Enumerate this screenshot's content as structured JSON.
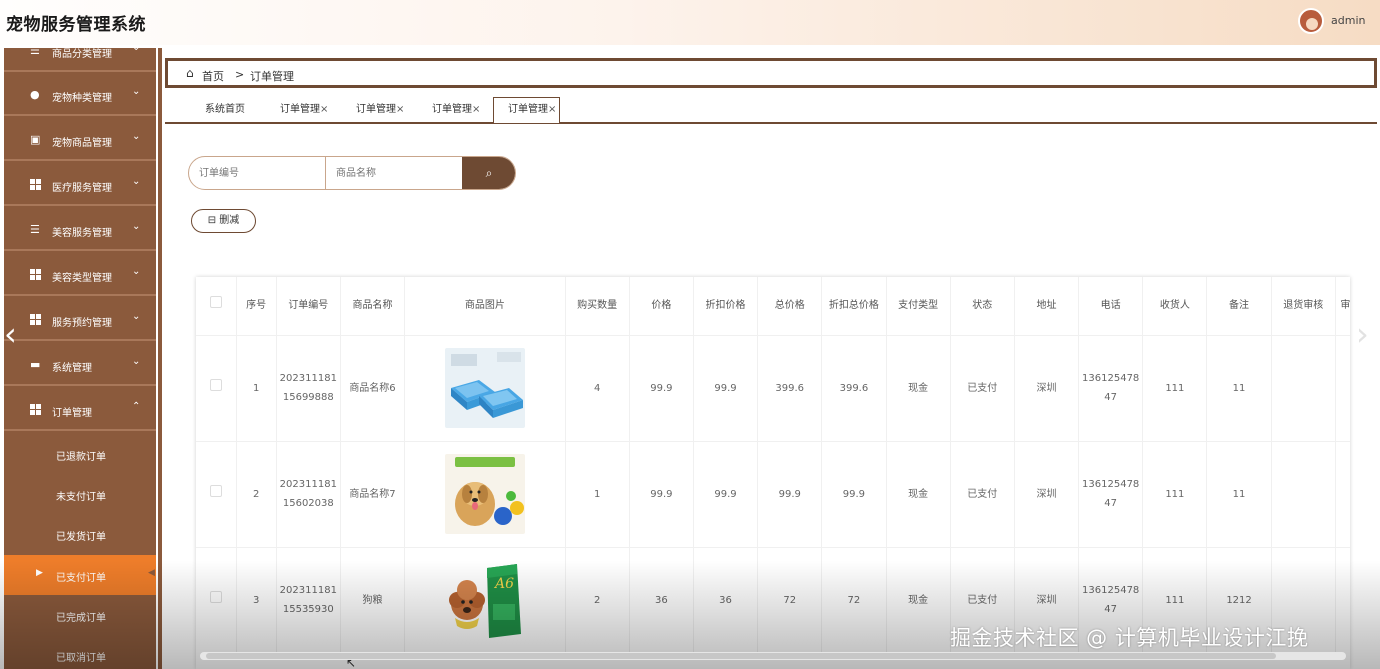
{
  "app": {
    "title": "宠物服务管理系统",
    "user": "admin"
  },
  "sidebar": {
    "items": [
      {
        "label": "商品分类管理",
        "icon": "menu-icon"
      },
      {
        "label": "宠物种类管理",
        "icon": "bulb-icon"
      },
      {
        "label": "宠物商品管理",
        "icon": "clipboard-icon"
      },
      {
        "label": "医疗服务管理",
        "icon": "grid-icon"
      },
      {
        "label": "美容服务管理",
        "icon": "menu-icon"
      },
      {
        "label": "美容类型管理",
        "icon": "grid-icon"
      },
      {
        "label": "服务预约管理",
        "icon": "grid-icon"
      },
      {
        "label": "系统管理",
        "icon": "printer-icon"
      },
      {
        "label": "订单管理",
        "icon": "grid-icon"
      }
    ],
    "subitems": [
      {
        "label": "已退款订单"
      },
      {
        "label": "未支付订单"
      },
      {
        "label": "已发货订单"
      },
      {
        "label": "已支付订单"
      },
      {
        "label": "已完成订单"
      },
      {
        "label": "已取消订单"
      }
    ]
  },
  "breadcrumb": {
    "home": "首页",
    "sep": ">",
    "current": "订单管理"
  },
  "tabs": [
    {
      "label": "系统首页",
      "closable": ""
    },
    {
      "label": "订单管理",
      "closable": "×"
    },
    {
      "label": "订单管理",
      "closable": "×"
    },
    {
      "label": "订单管理",
      "closable": "×"
    },
    {
      "label": "订单管理",
      "closable": "×"
    }
  ],
  "search": {
    "order_placeholder": "订单编号",
    "name_placeholder": "商品名称",
    "search_icon": "search-icon"
  },
  "actions": {
    "delete_label": "删减",
    "delete_icon": "minus-square-icon"
  },
  "table": {
    "headers": [
      "序号",
      "订单编号",
      "商品名称",
      "商品图片",
      "购买数量",
      "价格",
      "折扣价格",
      "总价格",
      "折扣总价格",
      "支付类型",
      "状态",
      "地址",
      "电话",
      "收货人",
      "备注",
      "退货审核",
      "审"
    ],
    "rows": [
      {
        "index": "1",
        "order_no": "20231118115699888",
        "name": "商品名称6",
        "image": "blue-pet-bed",
        "qty": "4",
        "price": "99.9",
        "discount_price": "99.9",
        "total": "399.6",
        "discount_total": "399.6",
        "pay_type": "现金",
        "status": "已支付",
        "address": "深圳",
        "phone": "13612547847",
        "receiver": "111",
        "note": "11",
        "return_review": ""
      },
      {
        "index": "2",
        "order_no": "20231118115602038",
        "name": "商品名称7",
        "image": "dog-with-balls",
        "qty": "1",
        "price": "99.9",
        "discount_price": "99.9",
        "total": "99.9",
        "discount_total": "99.9",
        "pay_type": "现金",
        "status": "已支付",
        "address": "深圳",
        "phone": "13612547847",
        "receiver": "111",
        "note": "11",
        "return_review": ""
      },
      {
        "index": "3",
        "order_no": "20231118115535930",
        "name": "狗粮",
        "image": "poodle-dog-food",
        "qty": "2",
        "price": "36",
        "discount_price": "36",
        "total": "72",
        "discount_total": "72",
        "pay_type": "现金",
        "status": "已支付",
        "address": "深圳",
        "phone": "13612547847",
        "receiver": "111",
        "note": "1212",
        "return_review": ""
      }
    ]
  },
  "watermark": "掘金技术社区 @ 计算机毕业设计江挽",
  "colors": {
    "primary": "#8b5a3c",
    "accent": "#ee7d2a",
    "dark": "#6e4a33"
  }
}
